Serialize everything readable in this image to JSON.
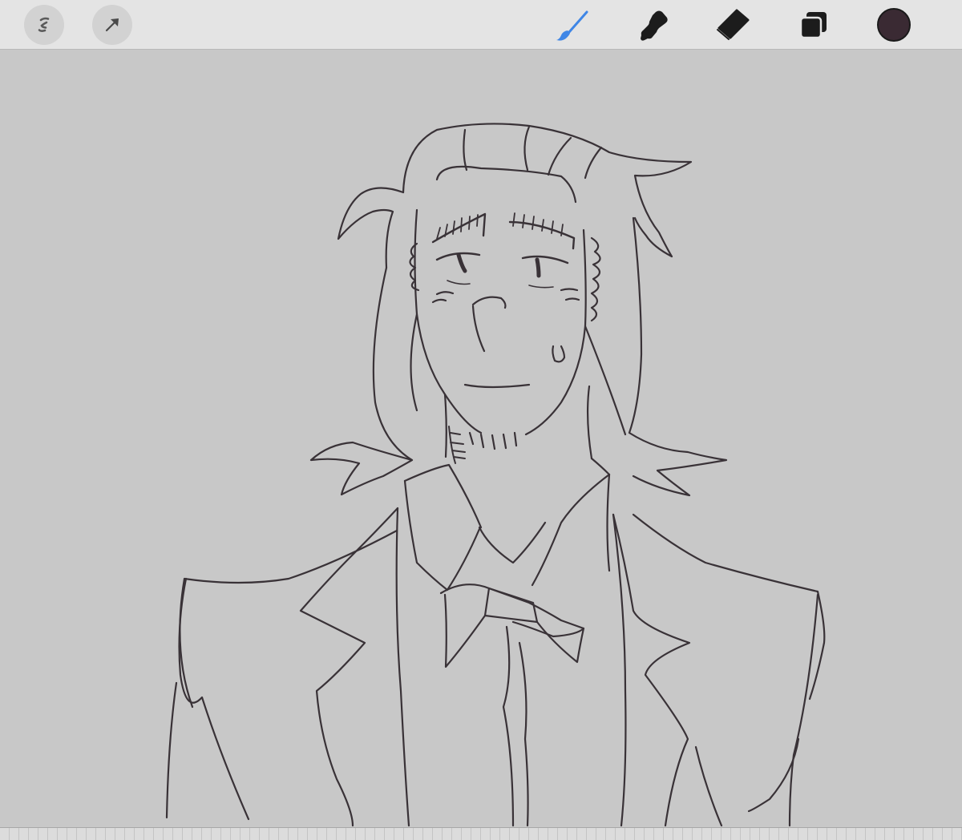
{
  "toolbar": {
    "left_buttons": [
      {
        "icon": "adjustments-icon"
      },
      {
        "icon": "selection-arrow-icon"
      }
    ],
    "tools": [
      {
        "icon": "brush-icon",
        "active": true
      },
      {
        "icon": "smudge-icon",
        "active": false
      },
      {
        "icon": "eraser-icon",
        "active": false
      },
      {
        "icon": "layers-icon",
        "active": false
      }
    ],
    "current_color": "#3a2a33"
  },
  "colors": {
    "toolbar_bg": "#e4e4e4",
    "canvas_bg": "#c8c8c8",
    "active_tool": "#3f86e6",
    "inactive_tool": "#1c1c1c",
    "stroke": "#2a2228"
  }
}
